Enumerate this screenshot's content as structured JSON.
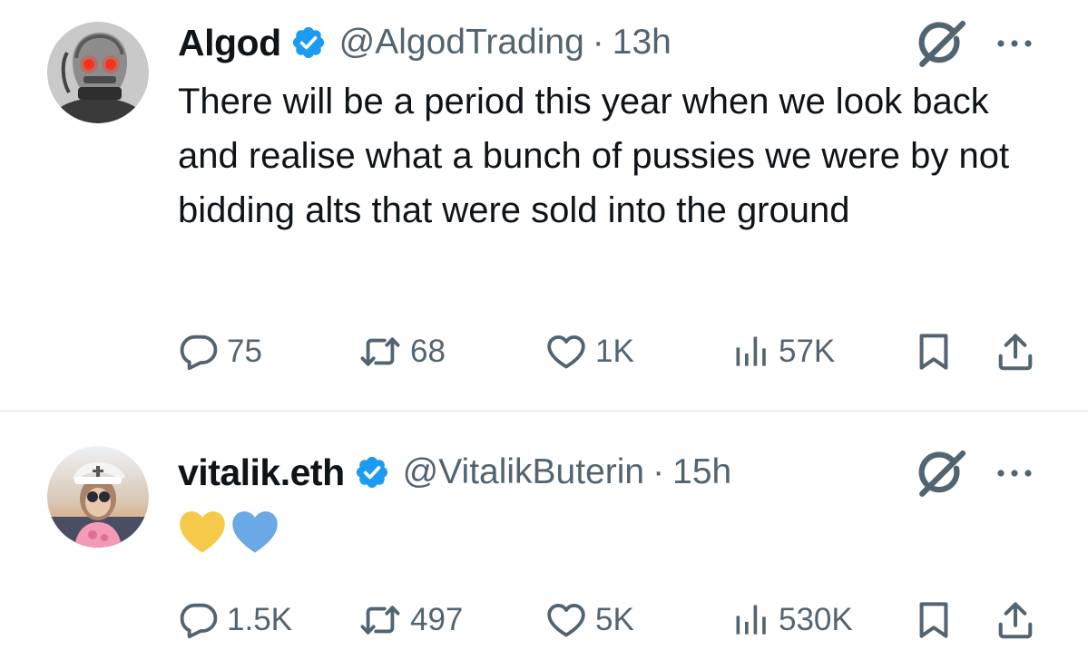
{
  "tweets": [
    {
      "name": "Algod",
      "handle": "@AlgodTrading",
      "separator": "·",
      "time": "13h",
      "text": "There will be a period this year when we look back and realise what a bunch of pussies we were by not bidding alts that were sold into the ground",
      "emojis": [],
      "avatar": "robot-avatar",
      "verified": true,
      "stats": {
        "replies": "75",
        "reposts": "68",
        "likes": "1K",
        "views": "57K"
      }
    },
    {
      "name": "vitalik.eth",
      "handle": "@VitalikButerin",
      "separator": "·",
      "time": "15h",
      "text": "",
      "emojis": [
        "yellow-heart-emoji",
        "blue-heart-emoji"
      ],
      "avatar": "cartoon-avatar",
      "verified": true,
      "stats": {
        "replies": "1.5K",
        "reposts": "497",
        "likes": "5K",
        "views": "530K"
      }
    }
  ],
  "icons": {
    "reply": "reply-icon",
    "repost": "repost-icon",
    "like": "heart-icon",
    "views": "views-icon",
    "bookmark": "bookmark-icon",
    "share": "share-icon",
    "grok": "grok-icon",
    "more": "more-icon",
    "verified": "verified-badge-icon"
  },
  "colors": {
    "text": "#0f1419",
    "secondary": "#536471",
    "verified": "#1d9bf0",
    "divider": "#eff3f4",
    "yellow_heart": "#f5c94a",
    "blue_heart": "#6aa8e6"
  }
}
